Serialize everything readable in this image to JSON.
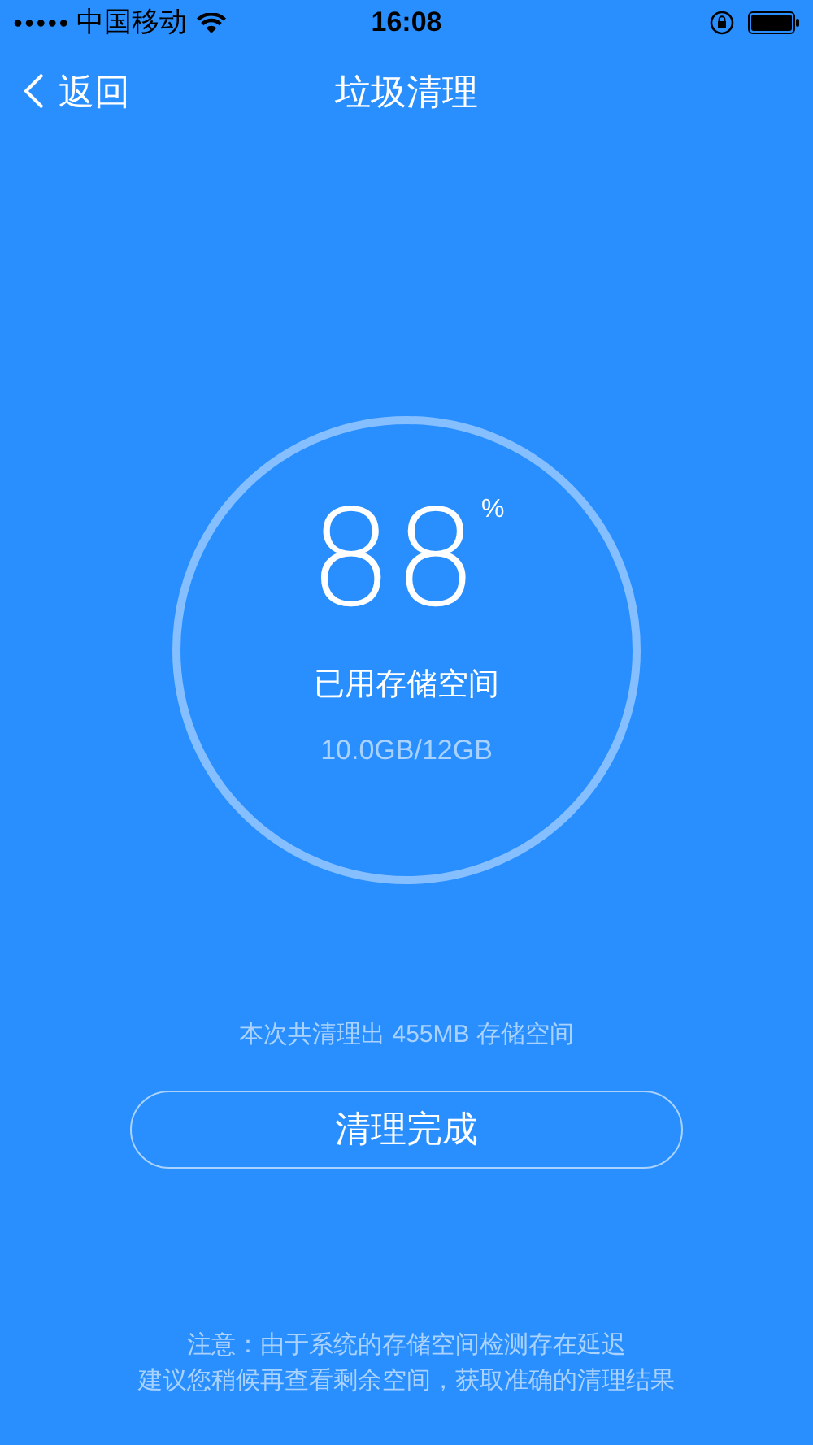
{
  "status_bar": {
    "signal_dots": "●●●●●",
    "carrier": "中国移动",
    "time": "16:08"
  },
  "nav": {
    "back_label": "返回",
    "title": "垃圾清理"
  },
  "usage": {
    "percent": "88",
    "percent_sign": "%",
    "label": "已用存储空间",
    "detail": "10.0GB/12GB"
  },
  "summary": "本次共清理出 455MB 存储空间",
  "done_button": "清理完成",
  "notes": [
    "注意：由于系统的存储空间检测存在延迟",
    "建议您稍候再查看剩余空间，获取准确的清理结果"
  ]
}
